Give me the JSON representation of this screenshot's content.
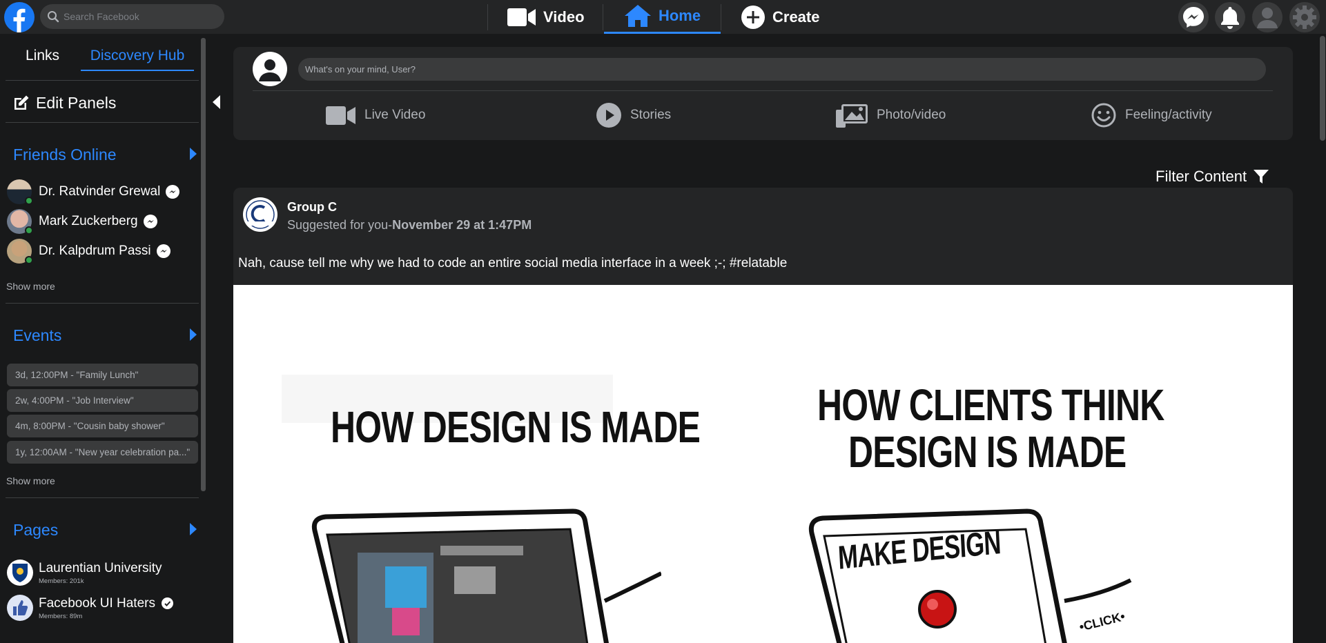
{
  "topbar": {
    "search_placeholder": "Search Facebook",
    "nav": [
      {
        "label": "Video",
        "icon": "video-camera-icon"
      },
      {
        "label": "Home",
        "icon": "home-icon",
        "active": true
      },
      {
        "label": "Create",
        "icon": "plus-circle-icon"
      }
    ],
    "right_icons": [
      "messenger-icon",
      "bell-icon",
      "profile-icon",
      "gear-icon"
    ]
  },
  "sidebar": {
    "tabs": [
      "Links",
      "Discovery Hub"
    ],
    "active_tab": "Discovery Hub",
    "edit_panels_label": "Edit Panels",
    "friends_online": {
      "title": "Friends Online",
      "friends": [
        {
          "name": "Dr. Ratvinder Grewal"
        },
        {
          "name": "Mark Zuckerberg"
        },
        {
          "name": "Dr. Kalpdrum Passi"
        }
      ],
      "show_more": "Show more"
    },
    "events": {
      "title": "Events",
      "items": [
        "3d, 12:00PM - \"Family Lunch\"",
        "2w, 4:00PM - \"Job Interview\"",
        "4m, 8:00PM - \"Cousin baby shower\"",
        "1y, 12:00AM - \"New year celebration pa...\""
      ],
      "show_more": "Show more"
    },
    "pages": {
      "title": "Pages",
      "items": [
        {
          "name": "Laurentian University",
          "members": "Members: 201k"
        },
        {
          "name": "Facebook UI Haters",
          "members": "Members: 89m"
        }
      ]
    }
  },
  "composer": {
    "placeholder": "What's on your mind, User?",
    "actions": [
      {
        "label": "Live Video",
        "icon": "video-camera-icon"
      },
      {
        "label": "Stories",
        "icon": "play-circle-icon"
      },
      {
        "label": "Photo/video",
        "icon": "photos-icon"
      },
      {
        "label": "Feeling/activity",
        "icon": "smiley-icon"
      }
    ]
  },
  "filter_label": "Filter Content",
  "post": {
    "group": "Group C",
    "suggested": "Suggested for you-",
    "date": "November 29 at 1:47PM",
    "text": "Nah, cause tell me why we had to code an entire social media interface in a week ;-; #relatable",
    "meme": {
      "left_heading": "HOW DESIGN IS MADE",
      "right_heading_1": "HOW CLIENTS THINK",
      "right_heading_2": "DESIGN IS MADE",
      "screen_text": "MAKE DESIGN",
      "click_text": "•CLICK•"
    }
  }
}
